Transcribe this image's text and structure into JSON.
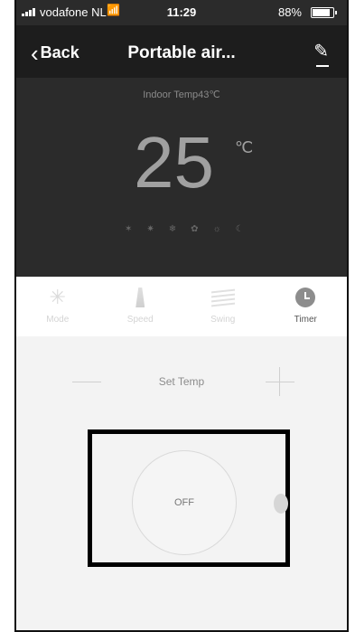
{
  "status_bar": {
    "carrier": "vodafone NL",
    "wifi_icon": "wifi-icon",
    "time": "11:29",
    "battery": "88%"
  },
  "nav": {
    "back_chevron": "‹",
    "back_label": "Back",
    "title": "Portable air...",
    "edit_icon": "✎"
  },
  "display": {
    "indoor_label": "Indoor Temp43℃",
    "set_temperature": "25",
    "unit": "℃",
    "mode_icons": [
      "✶",
      "✷",
      "❄",
      "✿",
      "☼",
      "☾"
    ]
  },
  "tabs": [
    {
      "label": "Mode",
      "icon": "fan-icon"
    },
    {
      "label": "Speed",
      "icon": "speed-icon"
    },
    {
      "label": "Swing",
      "icon": "swing-icon"
    },
    {
      "label": "Timer",
      "icon": "timer-icon",
      "active": true
    }
  ],
  "panel": {
    "set_temp_label": "Set Temp",
    "power_label": "OFF"
  }
}
